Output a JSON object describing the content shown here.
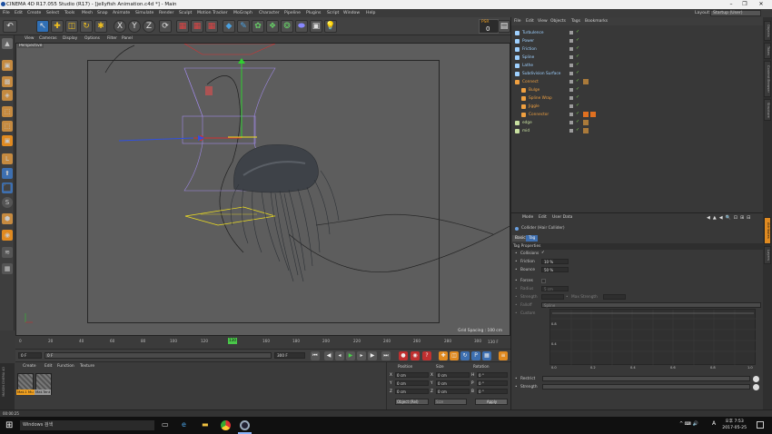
{
  "window": {
    "title": "CINEMA 4D R17.055 Studio (R17) - [jellyfish Animation.c4d *] - Main",
    "layout_label": "Layout:",
    "layout_value": "Startup (User)",
    "minimize": "–",
    "maximize": "❐",
    "close": "✕"
  },
  "menubar": [
    "File",
    "Edit",
    "Create",
    "Select",
    "Tools",
    "Mesh",
    "Snap",
    "Animate",
    "Simulate",
    "Render",
    "Sculpt",
    "Motion Tracker",
    "MoGraph",
    "Character",
    "Pipeline",
    "Plugins",
    "Script",
    "Window",
    "Help"
  ],
  "psr": {
    "label": "PSR",
    "value": "0"
  },
  "toolbar_axes": [
    "X",
    "Y",
    "Z"
  ],
  "viewport": {
    "menu": [
      "View",
      "Cameras",
      "Display",
      "Options",
      "Filter",
      "Panel"
    ],
    "camera_label": "Perspective",
    "grid_spacing": "Grid Spacing : 100 cm"
  },
  "timeline": {
    "ticks": [
      "0",
      "20",
      "40",
      "60",
      "80",
      "100",
      "120",
      "130",
      "140",
      "160",
      "180",
      "200",
      "220",
      "240",
      "260",
      "280",
      "300"
    ],
    "current_frame": "130",
    "end_label": "130 F"
  },
  "playback": {
    "start_field": "0 F",
    "min_field": "0 F",
    "max_field": "300 F",
    "end_field": "300 F"
  },
  "material_manager": {
    "menu": [
      "Create",
      "Edit",
      "Function",
      "Texture"
    ],
    "materials": [
      "Mat.1 Mu",
      "Mat.Tent"
    ],
    "logo": "MAXON CINEMA 4D"
  },
  "coordinates": {
    "headers": [
      "Position",
      "Size",
      "Rotation"
    ],
    "rows": [
      {
        "axis": "X",
        "pos": "0 cm",
        "size": "0 cm",
        "rot_axis": "H",
        "rot": "0 °"
      },
      {
        "axis": "Y",
        "pos": "0 cm",
        "size": "0 cm",
        "rot_axis": "P",
        "rot": "0 °"
      },
      {
        "axis": "Z",
        "pos": "0 cm",
        "size": "0 cm",
        "rot_axis": "B",
        "rot": "0 °"
      }
    ],
    "mode": "Object (Rel)",
    "size_mode": "Size",
    "apply": "Apply"
  },
  "object_manager": {
    "menu": [
      "File",
      "Edit",
      "View",
      "Objects",
      "Tags",
      "Bookmarks"
    ],
    "objects": [
      {
        "name": "Turbulence",
        "color": "#9ed0ff",
        "indent": 0
      },
      {
        "name": "Power",
        "color": "#9ed0ff",
        "indent": 0
      },
      {
        "name": "Friction",
        "color": "#9ed0ff",
        "indent": 0
      },
      {
        "name": "Spline",
        "color": "#9ed0ff",
        "indent": 0
      },
      {
        "name": "Lathe",
        "color": "#9ed0ff",
        "indent": 0
      },
      {
        "name": "Subdivision Surface",
        "color": "#9ed0ff",
        "indent": 0
      },
      {
        "name": "Connect",
        "color": "#f0a040",
        "indent": 0
      },
      {
        "name": "Bulge",
        "color": "#f0a040",
        "indent": 1
      },
      {
        "name": "Spline Wrap",
        "color": "#f0a040",
        "indent": 1
      },
      {
        "name": "Jiggle",
        "color": "#f0a040",
        "indent": 1
      },
      {
        "name": "Connector",
        "color": "#f0a040",
        "indent": 1
      },
      {
        "name": "edge",
        "color": "#c8e0a0",
        "indent": 0
      },
      {
        "name": "mid",
        "color": "#c8e0a0",
        "indent": 0
      }
    ]
  },
  "attributes": {
    "menu": [
      "Mode",
      "Edit",
      "User Data"
    ],
    "object_title": "Collider (Hair Collider)",
    "tabs": [
      "Basic",
      "Tag"
    ],
    "section": "Tag Properties",
    "collisions_label": "Collisions",
    "collisions_check": "✓",
    "friction_label": "Friction",
    "friction_value": "10 %",
    "bounce_label": "Bounce",
    "bounce_value": "50 %",
    "forces_label": "Forces",
    "radius_label": "Radius",
    "radius_value": "5 cm",
    "strength_label": "Strength",
    "strength_value": "",
    "max_strength_label": "Max Strength",
    "max_strength_value": "",
    "falloff_label": "Falloff",
    "falloff_value": "Spline",
    "custom_label": "Custom",
    "graph_y_ticks": [
      "0.8",
      "0.4"
    ],
    "graph_x_ticks": [
      "0.0",
      "0.2",
      "0.4",
      "0.6",
      "0.8",
      "1.0"
    ],
    "restrict_label": "Restrict",
    "strength2_label": "Strength"
  },
  "right_tabs": [
    "Objects",
    "Takes",
    "Content Browser",
    "Structure"
  ],
  "right_tabs_lower": [
    "Attributes",
    "Layers"
  ],
  "statusbar": "00:00:25",
  "taskbar": {
    "search": "Windows 검색",
    "time": "오후 7:53",
    "date": "2017-05-25",
    "lang": "A"
  }
}
